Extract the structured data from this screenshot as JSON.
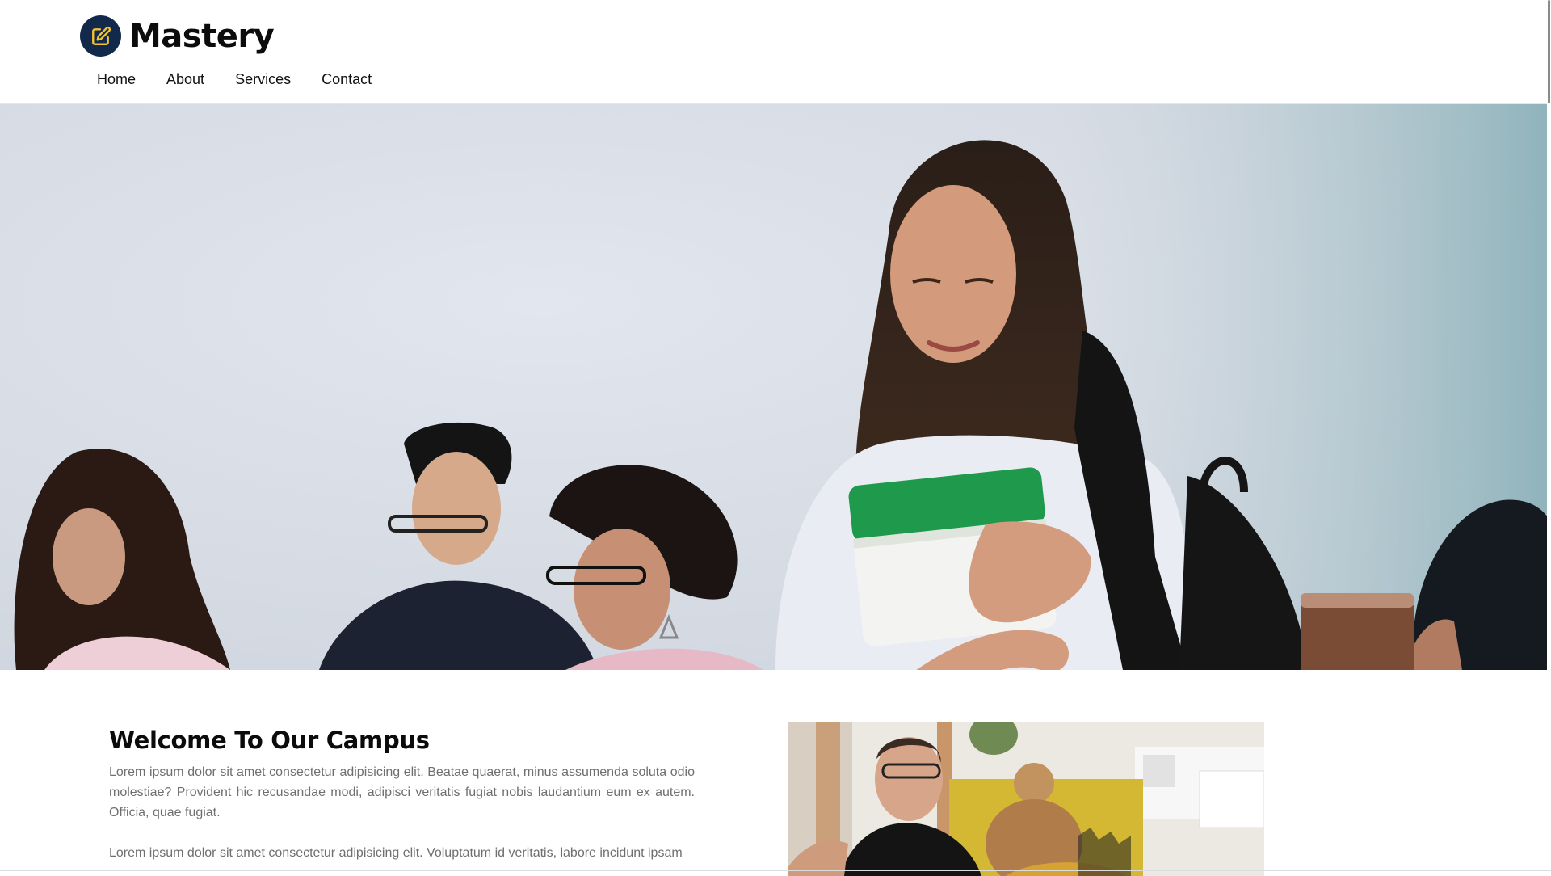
{
  "brand": {
    "name": "Mastery",
    "icon": "edit-icon",
    "logo_bg_color": "#13294b",
    "logo_icon_color": "#f2c230"
  },
  "nav": {
    "items": [
      {
        "label": "Home"
      },
      {
        "label": "About"
      },
      {
        "label": "Services"
      },
      {
        "label": "Contact"
      }
    ]
  },
  "hero": {
    "image": "students-classroom-photo"
  },
  "welcome": {
    "title": "Welcome To Our Campus",
    "paragraphs": [
      "Lorem ipsum dolor sit amet consectetur adipisicing elit. Beatae quaerat, minus assumenda soluta odio molestiae? Provident hic recusandae modi, adipisci veritatis fugiat nobis laudantium eum ex autem. Officia, quae fugiat.",
      "Lorem ipsum dolor sit amet consectetur adipisicing elit. Voluptatum id veritatis, labore incidunt ipsam"
    ],
    "side_image": "teacher-and-students-photo"
  }
}
